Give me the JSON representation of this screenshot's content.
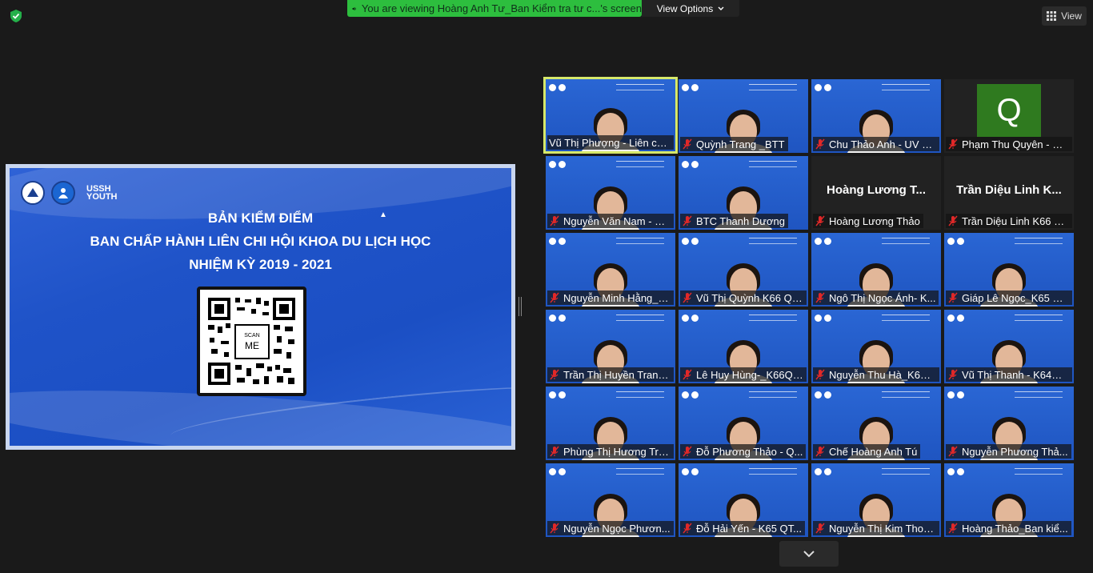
{
  "share_banner": {
    "text": "You are viewing Hoàng Anh Tư_Ban Kiểm tra tư c...'s screen"
  },
  "view_options": {
    "label": "View Options"
  },
  "view_button": {
    "label": "View"
  },
  "slide": {
    "title_line1": "BẢN KIỂM ĐIỂM",
    "title_line2": "BAN CHẤP HÀNH LIÊN CHI HỘI KHOA DU LỊCH HỌC",
    "title_line3": "NHIỆM KỲ 2019 - 2021",
    "qr_label_top": "SCAN",
    "qr_label_bottom": "ME",
    "logo_text_1": "USSH",
    "logo_text_2": "YOUTH"
  },
  "participants": [
    {
      "name": "Vũ Thị Phượng - Liên chi...",
      "muted": false,
      "active": true
    },
    {
      "name": "Quỳnh Trang _BTT",
      "muted": true
    },
    {
      "name": "Chu Thảo Anh - UV B...",
      "muted": true
    },
    {
      "name": "Phạm Thu Quyên - K6...",
      "muted": true,
      "avatar": "Q"
    },
    {
      "name": "Nguyễn Văn Nam - Đ...",
      "muted": true
    },
    {
      "name": "BTC Thanh Dương",
      "muted": true
    },
    {
      "name": "Hoàng Lương Thảo",
      "muted": true,
      "no_video": true,
      "big": "Hoàng Lương T..."
    },
    {
      "name": "Trần Diệu Linh K66 Q...",
      "muted": true,
      "no_video": true,
      "big": "Trần Diệu Linh K..."
    },
    {
      "name": "Nguyễn Minh Hằng_K...",
      "muted": true
    },
    {
      "name": "Vũ Thị Quỳnh K66 QT...",
      "muted": true
    },
    {
      "name": "Ngô Thị Ngọc Ánh- K...",
      "muted": true
    },
    {
      "name": "Giáp Lê Ngọc_K65 Q...",
      "muted": true
    },
    {
      "name": "Trần Thị Huyền Trang...",
      "muted": true
    },
    {
      "name": "Lê Huy Hùng-_K66QT...",
      "muted": true
    },
    {
      "name": "Nguyễn Thu Hà_K64 ...",
      "muted": true
    },
    {
      "name": "Vũ Thị Thanh - K64QT...",
      "muted": true
    },
    {
      "name": "Phùng Thị Hương Trà...",
      "muted": true
    },
    {
      "name": "Đỗ Phương Thảo - Q...",
      "muted": true
    },
    {
      "name": "Chế Hoàng Anh Tú",
      "muted": true
    },
    {
      "name": "Nguyễn Phương Thả...",
      "muted": true
    },
    {
      "name": "Nguyễn Ngọc Phươn...",
      "muted": true
    },
    {
      "name": "Đỗ Hải Yến - K65 QT...",
      "muted": true
    },
    {
      "name": "Nguyễn Thị Kim Thoa...",
      "muted": true
    },
    {
      "name": "Hoàng Thảo_Ban kiể...",
      "muted": true
    }
  ],
  "colors": {
    "share_green": "#2dbe3e",
    "slide_blue": "#1f53c8",
    "active_border": "#d6e86a",
    "mute_red": "#e02828"
  }
}
